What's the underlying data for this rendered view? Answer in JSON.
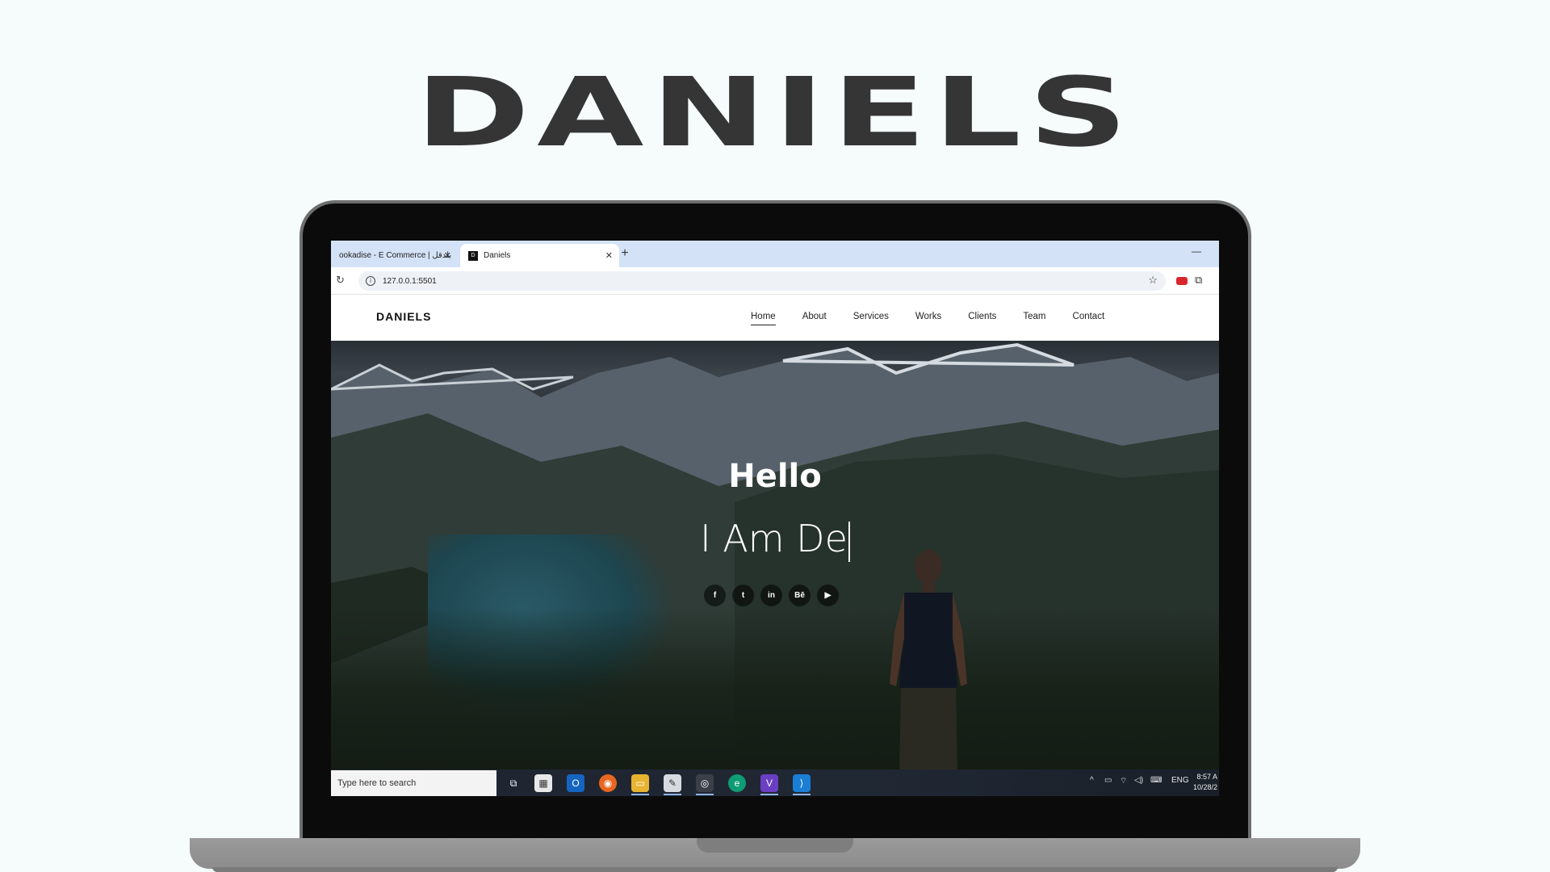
{
  "page_title": "DANIELS",
  "browser": {
    "tabs": [
      {
        "label": "ookadise - E Commerce | بلدقل",
        "active": false
      },
      {
        "label": "Daniels",
        "active": true,
        "favicon": "d-logo-icon"
      }
    ],
    "url": "127.0.0.1:5501",
    "window_control": "—"
  },
  "site": {
    "brand": "DANIELS",
    "nav": [
      "Home",
      "About",
      "Services",
      "Works",
      "Clients",
      "Team",
      "Contact"
    ],
    "active_nav": "Home",
    "hero": {
      "greeting": "Hello",
      "typed_text": "I Am De",
      "social_icons": [
        "facebook-icon",
        "twitter-icon",
        "linkedin-icon",
        "behance-icon",
        "youtube-icon"
      ],
      "social_glyphs": [
        "f",
        "t",
        "in",
        "Bē",
        "▶"
      ]
    }
  },
  "taskbar": {
    "search_placeholder": "Type here to search",
    "lang": "ENG",
    "time": "8:57 A",
    "date": "10/28/2"
  },
  "colors": {
    "title": "#353535",
    "tabbar": "#d3e2f7",
    "taskbar": "#1e2430"
  }
}
